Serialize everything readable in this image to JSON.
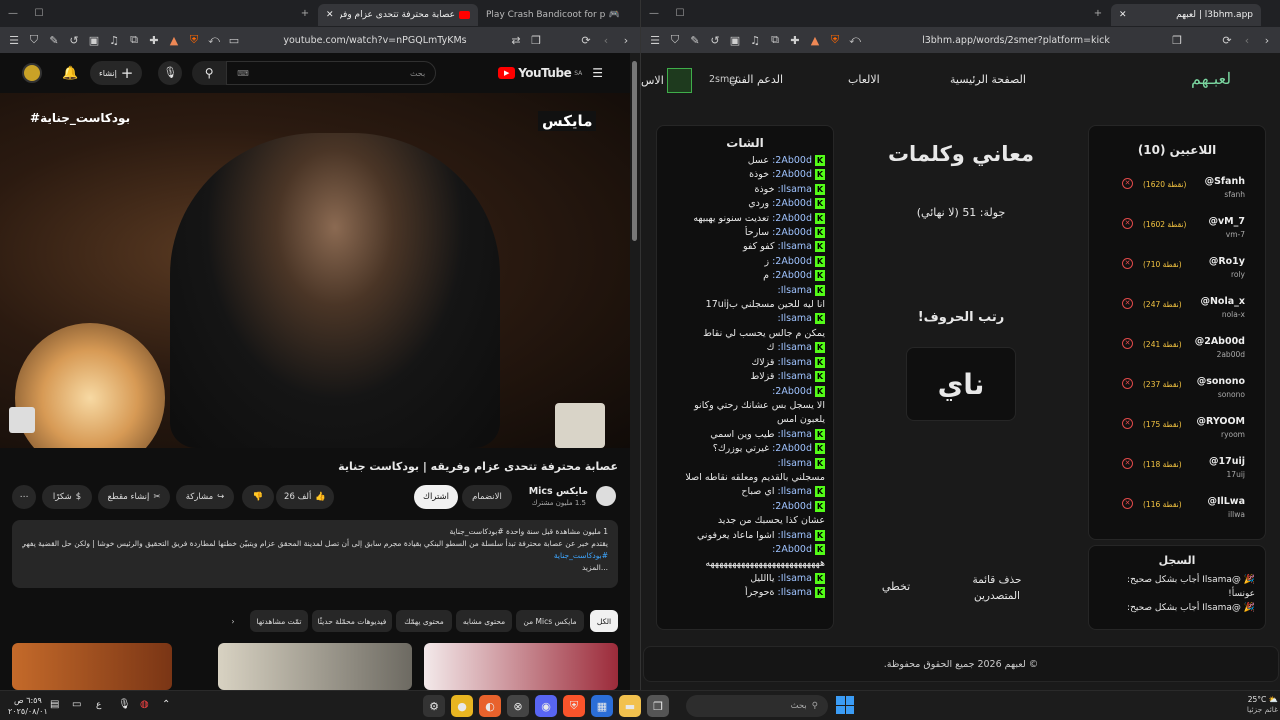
{
  "left": {
    "tabs": [
      {
        "title": "عصابة محترفة تتحدى عزام وفري"
      },
      {
        "title": "Play Crash Bandicoot for playstation"
      }
    ],
    "url": "youtube.com/watch?v=nPGQLmTyKMs",
    "youtube": {
      "logo": "YouTube",
      "region": "SA",
      "search_placeholder": "بحث",
      "create_label": "إنشاء",
      "video_hashtag": "#بودكاست_جناية",
      "brand_watermark": "مايكس",
      "title": "عصابة محترفة تتحدى عزام وفريقه | بودكاست جناية",
      "channel_name": "مايكس Mics",
      "subscribers": "1.5 مليون مشترك",
      "join_label": "الانضمام",
      "subscribe_label": "اشتراك",
      "likes": "26 ألف",
      "share_label": "مشاركة",
      "clip_label": "إنشاء مقطع",
      "thanks_label": "شكرًا",
      "description_meta": "1 مليون مشاهدة قبل سنة واحدة  #بودكاست_جناية",
      "description_text": "يقتدم خبر عن عصابة محترفة تبدأ سلسلة من السطو البنكي بقيادة مجرم سابق إلى أن تصل لمدينة المحقق عزام ويتبيّن خطتها لمطاردة فريق التحقيق والرئيس خوشا | ولكن حل القضية يفهي موسم",
      "description_tag": "#بودكاست_جناية",
      "more_label": "...المزيد",
      "chips": [
        "الكل",
        "من Mics مايكس",
        "محتوى مشابه",
        "محتوى يهمّك",
        "فيديوهات محمّلة حديثًا",
        "تمّت مشاهدتها"
      ]
    }
  },
  "right": {
    "tab_title": "لعبهم | l3bhm.app",
    "url": "l3bhm.app/words/2smer?platform=kick",
    "nav": {
      "logo": "لعبـهم",
      "home": "الصفحة الرئيسية",
      "games": "الالعاب",
      "support": "الدعم الفني",
      "username": "2smer",
      "extra": "الاس"
    },
    "players_title": "اللاعبين (10)",
    "players": [
      {
        "name": "@Sfanh",
        "user": "sfanh",
        "points": "(1620 نقطة)"
      },
      {
        "name": "@vM_7",
        "user": "vm-7",
        "points": "(1602 نقطة)"
      },
      {
        "name": "@Ro1y",
        "user": "roly",
        "points": "(710 نقطة)"
      },
      {
        "name": "@Nola_x",
        "user": "nola-x",
        "points": "(247 نقطة)"
      },
      {
        "name": "@2Ab00d",
        "user": "2ab00d",
        "points": "(241 نقطة)"
      },
      {
        "name": "@sonono",
        "user": "sonono",
        "points": "(237 نقطة)"
      },
      {
        "name": "@RYOOM",
        "user": "ryoom",
        "points": "(175 نقطة)"
      },
      {
        "name": "@17uij",
        "user": "17uij",
        "points": "(118 نقطة)"
      },
      {
        "name": "@IlLwa",
        "user": "illwa",
        "points": "(116 نقطة)"
      }
    ],
    "log_title": "السجل",
    "log": [
      "@Ilsama أجاب بشكل صحيح: عونسأ!",
      "@Ilsama أجاب بشكل صحيح:"
    ],
    "game_title": "معاني وكلمات",
    "round": "جولة: 51 (لا نهائي)",
    "instruction": "رتب الحروف!",
    "scrambled": "ناي",
    "btn_clear_leaderboard": "حذف قائمة المتصدرين",
    "btn_skip": "تخطي",
    "chat_title": "الشات",
    "chat": [
      {
        "user": "2Ab00d:",
        "msg": "عسل",
        "kick": true
      },
      {
        "user": "2Ab00d:",
        "msg": "خوذة",
        "kick": true
      },
      {
        "user": "Ilsama:",
        "msg": "خوذة",
        "kick": true
      },
      {
        "user": "2Ab00d:",
        "msg": "وردي",
        "kick": true
      },
      {
        "user": "2Ab00d:",
        "msg": "تعديت سنونو يهبيهه",
        "kick": true
      },
      {
        "user": "2Ab00d:",
        "msg": "سارحأ",
        "kick": true
      },
      {
        "user": "Ilsama:",
        "msg": "كفو كفو",
        "kick": true
      },
      {
        "user": "2Ab00d:",
        "msg": "ز",
        "kick": true
      },
      {
        "user": "2Ab00d:",
        "msg": "م",
        "kick": true
      },
      {
        "user": "Ilsama:",
        "msg": "",
        "kick": true
      },
      {
        "user": "",
        "msg": "انا ليه للحين مسجلني ب17uij",
        "kick": false
      },
      {
        "user": "Ilsama:",
        "msg": "",
        "kick": true
      },
      {
        "user": "",
        "msg": "يمكن م جالس يحسب لي نقاط",
        "kick": false
      },
      {
        "user": "Ilsama:",
        "msg": "ك",
        "kick": true
      },
      {
        "user": "Ilsama:",
        "msg": "قزلاك",
        "kick": true
      },
      {
        "user": "Ilsama:",
        "msg": "قزلاط",
        "kick": true
      },
      {
        "user": "2Ab00d:",
        "msg": "",
        "kick": true
      },
      {
        "user": "",
        "msg": "الا يسجل بس عشانك رحتي وكانو",
        "kick": false
      },
      {
        "user": "",
        "msg": "يلعبون امس",
        "kick": false
      },
      {
        "user": "Ilsama:",
        "msg": "طيب وين اسمي",
        "kick": true
      },
      {
        "user": "2Ab00d:",
        "msg": "غيرتي يوزرك؟",
        "kick": true
      },
      {
        "user": "Ilsama:",
        "msg": "",
        "kick": true
      },
      {
        "user": "",
        "msg": "مسجلني بالقديم ومعلقه نقاطه اصلا",
        "kick": false
      },
      {
        "user": "",
        "msg": "",
        "kick": false
      },
      {
        "user": "Ilsama:",
        "msg": "اي صباح",
        "kick": true
      },
      {
        "user": "2Ab00d:",
        "msg": "",
        "kick": true
      },
      {
        "user": "",
        "msg": "عشان كذا يحسبك من جديد",
        "kick": false
      },
      {
        "user": "Ilsama:",
        "msg": "اشوا ماعاد يعرفوني",
        "kick": true
      },
      {
        "user": "2Ab00d:",
        "msg": "",
        "kick": true
      },
      {
        "user": "",
        "msg": "ههههههههههههههههههههههههههه",
        "kick": false
      },
      {
        "user": "Ilsama:",
        "msg": "ياالليل",
        "kick": true
      },
      {
        "user": "Ilsama:",
        "msg": "ةحوجرأ",
        "kick": true
      }
    ],
    "footer": "© لعبهم 2026 جميع الحقوق محفوظة."
  },
  "taskbar": {
    "weather_temp": "25°C",
    "weather_desc": "غائم جزئيا",
    "search_placeholder": "بحث",
    "time": "٦:٥٩ ص",
    "date": "٢٠٢٥/٠٨/٠١",
    "lang": "ع"
  }
}
